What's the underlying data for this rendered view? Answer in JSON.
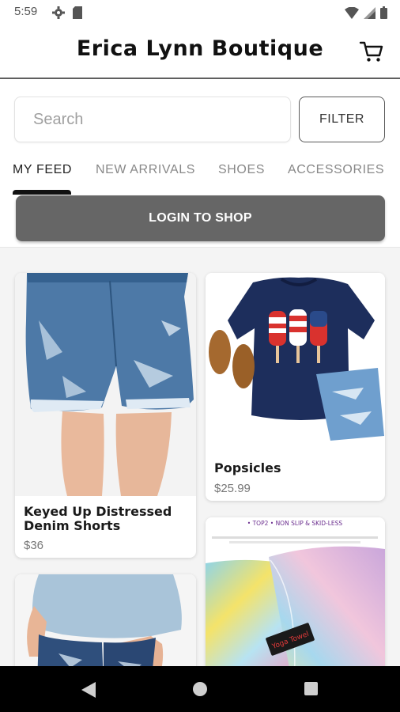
{
  "status_bar": {
    "time": "5:59"
  },
  "app": {
    "title": "Erica Lynn Boutique"
  },
  "search": {
    "placeholder": "Search",
    "value": ""
  },
  "filter": {
    "label": "FILTER"
  },
  "tabs": [
    {
      "label": "MY FEED",
      "active": true
    },
    {
      "label": "NEW ARRIVALS",
      "active": false
    },
    {
      "label": "SHOES",
      "active": false
    },
    {
      "label": "ACCESSORIES",
      "active": false
    }
  ],
  "login": {
    "label": "LOGIN TO SHOP"
  },
  "products": [
    {
      "title": "Keyed Up Distressed Denim Shorts",
      "title_line1": "Keyed Up Distressed",
      "title_line2": "Denim Shorts",
      "price": "$36"
    },
    {
      "title": "Popsicles",
      "price": "$25.99"
    },
    {
      "title": "",
      "price": ""
    },
    {
      "title": "",
      "price": "",
      "banner_text": "• TOP2 • NON SLIP & SKID-LESS",
      "tag_text": "Yoga Towel"
    }
  ],
  "colors": {
    "accent": "#111111",
    "login_button": "#666666",
    "divider": "#5f5f5f"
  }
}
